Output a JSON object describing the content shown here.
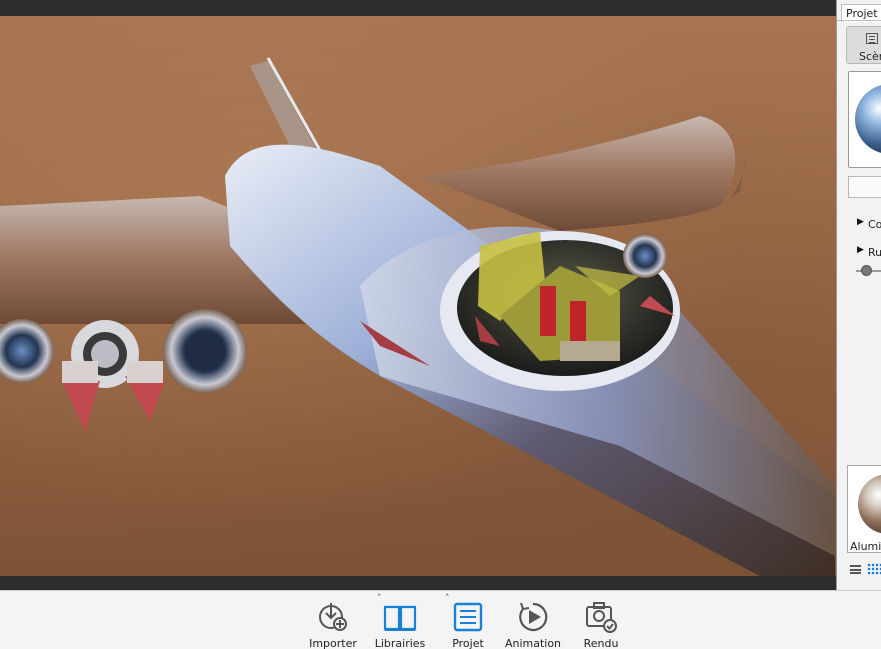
{
  "viewport": {
    "scene": "render-preview"
  },
  "right_panel": {
    "tab_label": "Projet",
    "scene_button_label": "Scèn",
    "row1_label": "Co",
    "row2_label": "Ru",
    "material_label": "Alumi"
  },
  "toolbar": {
    "importer_label": "Importer",
    "librairies_label": "Librairies",
    "projet_label": "Projet",
    "animation_label": "Animation",
    "rendu_label": "Rendu"
  },
  "colors": {
    "accent": "#1a7fd6",
    "panel_bg": "#f2f2f2",
    "toolbar_bg": "#f4f4f4",
    "chrome_dark": "#2d2d2d"
  },
  "icons": {
    "importer": "import-icon",
    "librairies": "book-icon",
    "projet": "list-icon",
    "animation": "play-circle-icon",
    "rendu": "camera-check-icon"
  }
}
